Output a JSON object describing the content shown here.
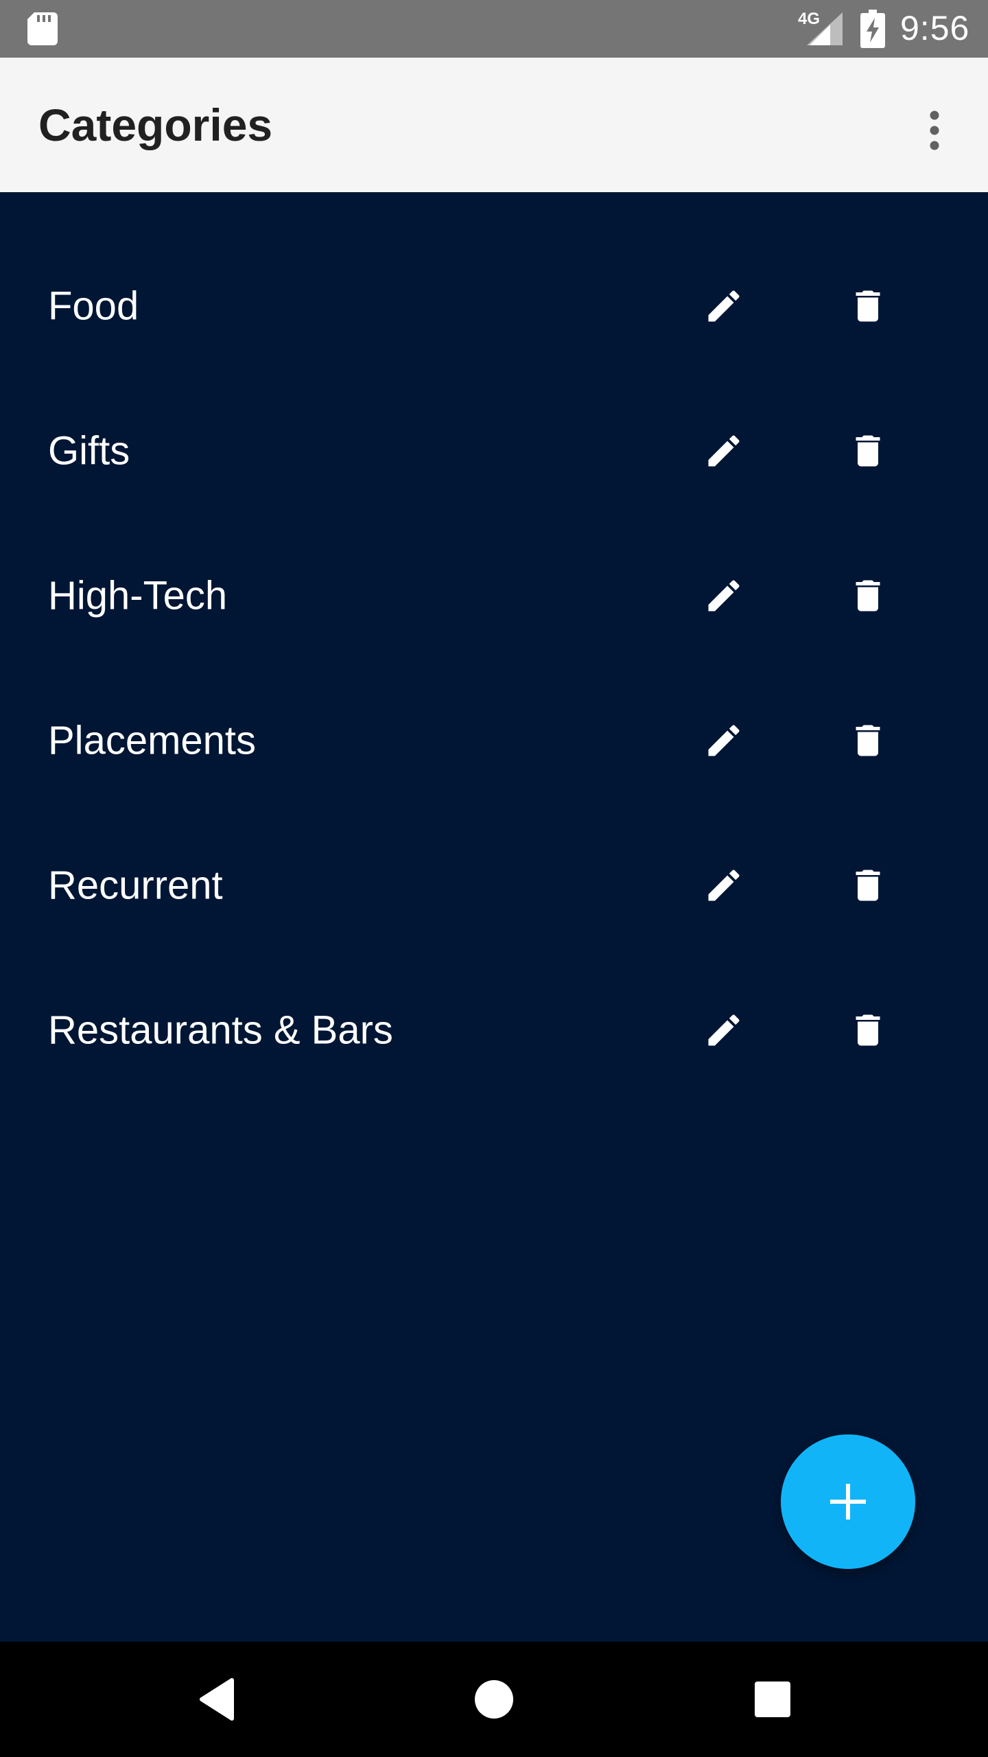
{
  "status_bar": {
    "network_type": "4G",
    "time": "9:56",
    "icons": [
      "sd-card-icon",
      "signal-icon",
      "battery-charging-icon"
    ]
  },
  "app_bar": {
    "title": "Categories",
    "menu_icon": "more-vert-icon"
  },
  "categories": [
    {
      "label": "Food"
    },
    {
      "label": "Gifts"
    },
    {
      "label": "High-Tech"
    },
    {
      "label": "Placements"
    },
    {
      "label": "Recurrent"
    },
    {
      "label": "Restaurants & Bars"
    }
  ],
  "row_actions": {
    "edit_icon": "pencil-icon",
    "delete_icon": "trash-icon"
  },
  "fab": {
    "icon": "plus-icon",
    "color": "#12b4f8"
  },
  "nav_bar": {
    "buttons": [
      "back-icon",
      "home-icon",
      "recents-icon"
    ]
  },
  "colors": {
    "background": "#011634",
    "app_bar": "#f5f5f5",
    "status_bar": "#757575"
  }
}
